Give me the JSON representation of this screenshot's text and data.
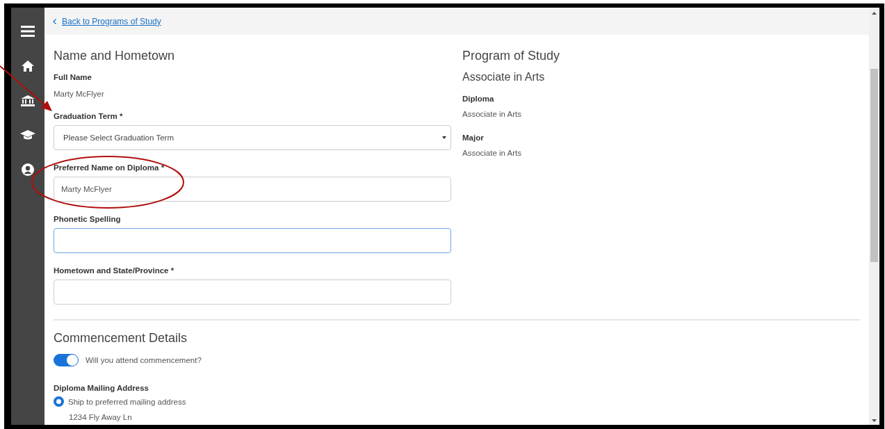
{
  "back_link": "Back to Programs of Study",
  "name_section": {
    "title": "Name and Hometown",
    "full_name_label": "Full Name",
    "full_name": "Marty McFlyer",
    "fields": [
      {
        "kind": "select",
        "label": "Graduation Term *",
        "placeholder": "Please Select Graduation Term",
        "focused": false
      },
      {
        "kind": "text",
        "label": "Preferred Name on Diploma *",
        "value": "Marty McFlyer",
        "focused": false
      },
      {
        "kind": "text",
        "label": "Phonetic Spelling",
        "focused": true
      },
      {
        "kind": "text",
        "label": "Hometown and State/Province *",
        "focused": false
      }
    ]
  },
  "program": {
    "title": "Program of Study",
    "name": "Associate in Arts",
    "details": [
      {
        "label": "Diploma",
        "value": "Associate in Arts"
      },
      {
        "label": "Major",
        "value": "Associate in Arts"
      }
    ]
  },
  "commencement": {
    "title": "Commencement Details",
    "attend": {
      "label": "Will you attend commencement?",
      "on": true
    },
    "mailing": {
      "label": "Diploma Mailing Address",
      "options": [
        {
          "label": "Ship to preferred mailing address",
          "selected": true,
          "address": "1234 Fly Away Ln"
        }
      ]
    }
  }
}
